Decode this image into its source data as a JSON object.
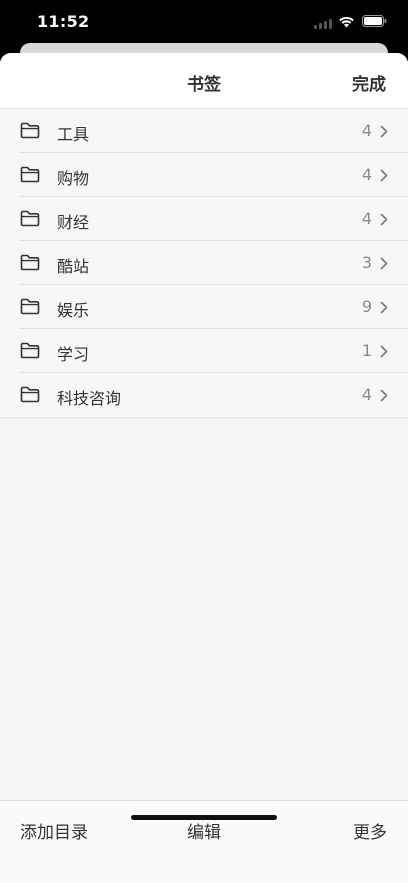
{
  "status_bar": {
    "time": "11:52",
    "icons": [
      "cellular-signal-icon",
      "wifi-icon",
      "battery-icon"
    ]
  },
  "nav": {
    "title": "书签",
    "done_label": "完成"
  },
  "folders": [
    {
      "label": "工具",
      "count": "4",
      "icon": "folder-icon"
    },
    {
      "label": "购物",
      "count": "4",
      "icon": "folder-icon"
    },
    {
      "label": "财经",
      "count": "4",
      "icon": "folder-icon"
    },
    {
      "label": "酷站",
      "count": "3",
      "icon": "folder-icon"
    },
    {
      "label": "娱乐",
      "count": "9",
      "icon": "folder-icon"
    },
    {
      "label": "学习",
      "count": "1",
      "icon": "folder-icon"
    },
    {
      "label": "科技咨询",
      "count": "4",
      "icon": "folder-icon"
    }
  ],
  "toolbar": {
    "add_folder_label": "添加目录",
    "edit_label": "编辑",
    "more_label": "更多"
  },
  "colors": {
    "text": "#333333",
    "count": "#8a8a8a",
    "sheet_bg": "#f4f4f4"
  }
}
